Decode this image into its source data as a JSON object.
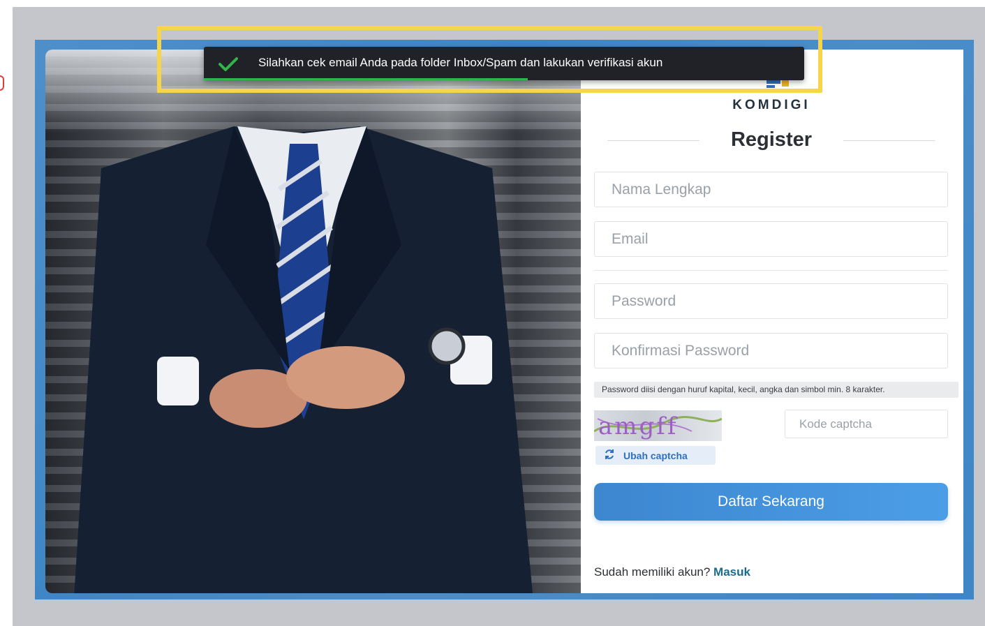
{
  "toast": {
    "message": "Silahkan cek email Anda pada folder Inbox/Spam dan lakukan verifikasi akun",
    "progress": 0.54,
    "accent": "#33b44a",
    "icon": "checkmark-icon"
  },
  "brand": {
    "name": "KOMDIGI"
  },
  "form": {
    "title": "Register",
    "name_placeholder": "Nama Lengkap",
    "email_placeholder": "Email",
    "password_placeholder": "Password",
    "confirm_placeholder": "Konfirmasi Password",
    "password_hint": "Password diisi dengan huruf kapital, kecil, angka dan simbol min. 8 karakter.",
    "captcha_text": "amgff",
    "captcha_placeholder": "Kode captcha",
    "refresh_label": "Ubah captcha",
    "submit_label": "Daftar Sekarang",
    "login_prompt": "Sudah memiliki akun?",
    "login_link": "Masuk"
  },
  "colors": {
    "frame_blue": "#3f86c6",
    "button_blue": "#4596dd",
    "highlight_yellow": "#f7d54b",
    "link": "#1a6c8c"
  }
}
